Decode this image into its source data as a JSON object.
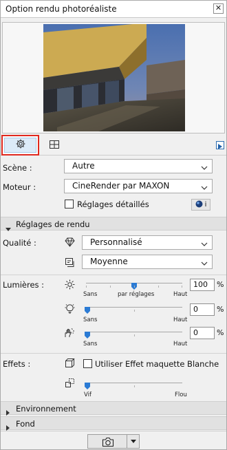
{
  "window": {
    "title": "Option rendu photoréaliste",
    "close_glyph": "✕"
  },
  "tabs": {
    "settings_icon": "gear-icon",
    "window_icon": "window-grid-icon",
    "expand_icon": "triangle-right-icon"
  },
  "scene": {
    "label": "Scène :",
    "value": "Autre"
  },
  "engine": {
    "label": "Moteur :",
    "value": "CineRender par MAXON"
  },
  "detailed": {
    "label": "Réglages détaillés",
    "checked": false,
    "info_glyph": "i"
  },
  "render_settings": {
    "title": "Réglages de rendu",
    "expanded": true
  },
  "quality": {
    "label": "Qualité :",
    "preset": "Personnalisé",
    "level": "Moyenne"
  },
  "lights": {
    "label": "Lumières :",
    "sun": {
      "value": "100",
      "unit": "%",
      "min_label": "Sans",
      "mid_label": "par réglages",
      "max_label": "Haut",
      "level": 0.5
    },
    "lamp": {
      "value": "0",
      "unit": "%",
      "min_label": "Sans",
      "max_label": "Haut",
      "level": 0.0
    },
    "hand": {
      "value": "0",
      "unit": "%",
      "min_label": "Sans",
      "max_label": "Haut",
      "level": 0.0
    }
  },
  "effects": {
    "label": "Effets :",
    "white_model": {
      "label": "Utiliser Effet maquette Blanche",
      "checked": false
    },
    "edge": {
      "min_label": "Vif",
      "max_label": "Flou",
      "level": 0.0
    }
  },
  "environment": {
    "title": "Environnement",
    "expanded": false
  },
  "background": {
    "title": "Fond",
    "expanded": false
  },
  "footer": {
    "camera_icon": "camera-icon",
    "dropdown_icon": "triangle-down-icon"
  }
}
